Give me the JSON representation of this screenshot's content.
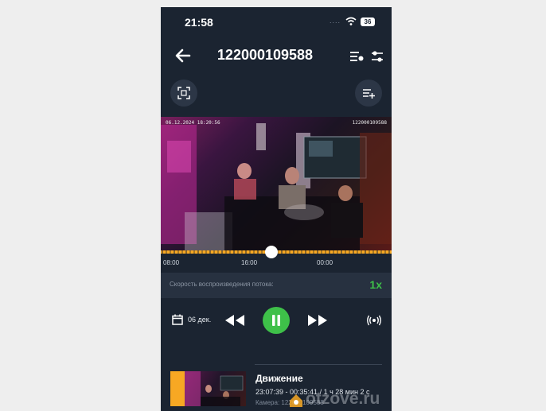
{
  "status_bar": {
    "time": "21:58",
    "signal_dots": "....",
    "battery": "36"
  },
  "header": {
    "title": "122000109588"
  },
  "video": {
    "osd_timestamp": "06.12.2024 18:20:56",
    "osd_camera_id": "122000109588"
  },
  "timeline": {
    "labels": [
      "08:00",
      "16:00",
      "00:00"
    ],
    "playhead_position": 0.48
  },
  "playback": {
    "speed_label": "Скорость воспроизведения потока:",
    "speed_value": "1x"
  },
  "controls": {
    "date_label": "06 дек."
  },
  "event": {
    "title": "Движение",
    "time_range": "23:07:39 - 00:35:41 / 1 ч 28 мин 2 с",
    "camera": "Камера: 122000109588"
  },
  "watermark": {
    "text": "otzove.ru"
  },
  "colors": {
    "accent_green": "#3ec049",
    "timeline_orange": "#f7a823",
    "background": "#1b2431"
  },
  "icons": [
    "wifi-icon",
    "back-icon",
    "playlist-icon",
    "settings-sliders-icon",
    "fullscreen-scan-icon",
    "add-to-list-icon",
    "calendar-icon",
    "rewind-icon",
    "play-pause-icon",
    "fast-forward-icon",
    "live-broadcast-icon"
  ]
}
